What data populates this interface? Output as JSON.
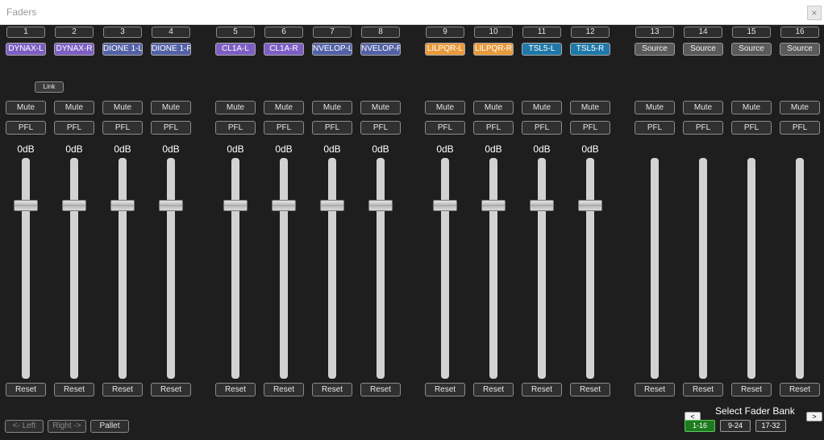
{
  "window": {
    "title": "Faders",
    "close_label": "×"
  },
  "link_label": "Link",
  "colors": {
    "purple": "#7d5fc4",
    "blue_grey": "#5361a6",
    "orange": "#e89a3c",
    "teal": "#1f78a8",
    "source": "#5a5a5a",
    "bank_active": "#1e7a1e"
  },
  "channels": [
    {
      "number": "1",
      "name": "DYNAX-L",
      "color": "purple",
      "mute": "Mute",
      "pfl": "PFL",
      "level": "0dB",
      "reset": "Reset",
      "fader": 0.8
    },
    {
      "number": "2",
      "name": "DYNAX-R",
      "color": "purple",
      "mute": "Mute",
      "pfl": "PFL",
      "level": "0dB",
      "reset": "Reset",
      "fader": 0.8
    },
    {
      "number": "3",
      "name": "DIONE 1-L",
      "color": "blue_grey",
      "mute": "Mute",
      "pfl": "PFL",
      "level": "0dB",
      "reset": "Reset",
      "fader": 0.8
    },
    {
      "number": "4",
      "name": "DIONE 1-R",
      "color": "blue_grey",
      "mute": "Mute",
      "pfl": "PFL",
      "level": "0dB",
      "reset": "Reset",
      "fader": 0.8
    },
    {
      "number": "5",
      "name": "CL1A-L",
      "color": "purple",
      "mute": "Mute",
      "pfl": "PFL",
      "level": "0dB",
      "reset": "Reset",
      "fader": 0.8
    },
    {
      "number": "6",
      "name": "CL1A-R",
      "color": "purple",
      "mute": "Mute",
      "pfl": "PFL",
      "level": "0dB",
      "reset": "Reset",
      "fader": 0.8
    },
    {
      "number": "7",
      "name": "NVELOP-L",
      "color": "blue_grey",
      "mute": "Mute",
      "pfl": "PFL",
      "level": "0dB",
      "reset": "Reset",
      "fader": 0.8
    },
    {
      "number": "8",
      "name": "NVELOP-R",
      "color": "blue_grey",
      "mute": "Mute",
      "pfl": "PFL",
      "level": "0dB",
      "reset": "Reset",
      "fader": 0.8
    },
    {
      "number": "9",
      "name": "LILPQR-L",
      "color": "orange",
      "mute": "Mute",
      "pfl": "PFL",
      "level": "0dB",
      "reset": "Reset",
      "fader": 0.8
    },
    {
      "number": "10",
      "name": "LILPQR-R",
      "color": "orange",
      "mute": "Mute",
      "pfl": "PFL",
      "level": "0dB",
      "reset": "Reset",
      "fader": 0.8
    },
    {
      "number": "11",
      "name": "TSL5-L",
      "color": "teal",
      "mute": "Mute",
      "pfl": "PFL",
      "level": "0dB",
      "reset": "Reset",
      "fader": 0.8
    },
    {
      "number": "12",
      "name": "TSL5-R",
      "color": "teal",
      "mute": "Mute",
      "pfl": "PFL",
      "level": "0dB",
      "reset": "Reset",
      "fader": 0.8
    },
    {
      "number": "13",
      "name": "Source",
      "color": "source",
      "mute": "Mute",
      "pfl": "PFL",
      "level": "",
      "reset": "Reset"
    },
    {
      "number": "14",
      "name": "Source",
      "color": "source",
      "mute": "Mute",
      "pfl": "PFL",
      "level": "",
      "reset": "Reset"
    },
    {
      "number": "15",
      "name": "Source",
      "color": "source",
      "mute": "Mute",
      "pfl": "PFL",
      "level": "",
      "reset": "Reset"
    },
    {
      "number": "16",
      "name": "Source",
      "color": "source",
      "mute": "Mute",
      "pfl": "PFL",
      "level": "",
      "reset": "Reset"
    }
  ],
  "footer": {
    "left_label": "<- Left",
    "right_label": "Right ->",
    "pallet_label": "Pallet",
    "bank_title": "Select Fader Bank",
    "prev_label": "<",
    "next_label": ">",
    "banks": [
      {
        "label": "1-16",
        "active": true
      },
      {
        "label": "9-24",
        "active": false
      },
      {
        "label": "17-32",
        "active": false
      }
    ]
  }
}
